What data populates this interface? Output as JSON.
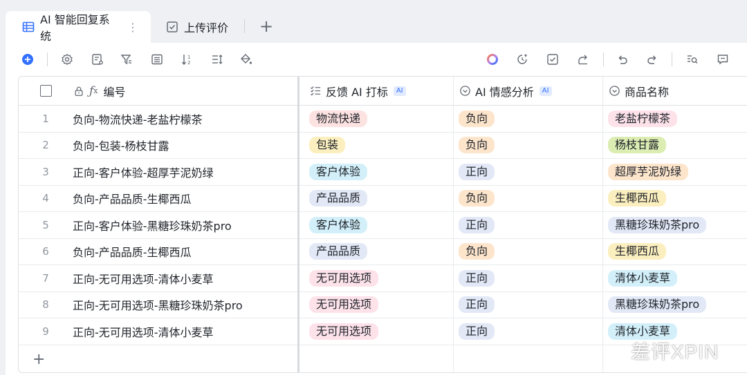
{
  "tabs": [
    {
      "label": "AI 智能回复系统",
      "icon": "table-icon",
      "active": true
    },
    {
      "label": "上传评价",
      "icon": "form-icon",
      "active": false
    }
  ],
  "columns": {
    "index": "",
    "code": "编号",
    "feedback": "反馈 AI 打标",
    "sentiment": "AI 情感分析",
    "product": "商品名称",
    "ai_badge": "AI"
  },
  "rows": [
    {
      "n": "1",
      "code": "负向-物流快递-老盐柠檬茶",
      "feedback": "物流快递",
      "sentiment": "负向",
      "product": "老盐柠檬茶"
    },
    {
      "n": "2",
      "code": "负向-包装-杨枝甘露",
      "feedback": "包装",
      "sentiment": "负向",
      "product": "杨枝甘露"
    },
    {
      "n": "3",
      "code": "正向-客户体验-超厚芋泥奶绿",
      "feedback": "客户体验",
      "sentiment": "正向",
      "product": "超厚芋泥奶绿"
    },
    {
      "n": "4",
      "code": "负向-产品品质-生椰西瓜",
      "feedback": "产品品质",
      "sentiment": "负向",
      "product": "生椰西瓜"
    },
    {
      "n": "5",
      "code": "正向-客户体验-黑糖珍珠奶茶pro",
      "feedback": "客户体验",
      "sentiment": "正向",
      "product": "黑糖珍珠奶茶pro"
    },
    {
      "n": "6",
      "code": "负向-产品品质-生椰西瓜",
      "feedback": "产品品质",
      "sentiment": "负向",
      "product": "生椰西瓜"
    },
    {
      "n": "7",
      "code": "正向-无可用选项-清体小麦草",
      "feedback": "无可用选项",
      "sentiment": "正向",
      "product": "清体小麦草"
    },
    {
      "n": "8",
      "code": "正向-无可用选项-黑糖珍珠奶茶pro",
      "feedback": "无可用选项",
      "sentiment": "正向",
      "product": "黑糖珍珠奶茶pro"
    },
    {
      "n": "9",
      "code": "正向-无可用选项-清体小麦草",
      "feedback": "无可用选项",
      "sentiment": "正向",
      "product": "清体小麦草"
    }
  ],
  "tag_colors": {
    "物流快递": "#fde2e2",
    "包装": "#fcefbf",
    "客户体验": "#d3f0fa",
    "产品品质": "#e2e8f6",
    "无可用选项": "#fde2ea",
    "负向": "#fde5cc",
    "正向": "#e2e8f6",
    "老盐柠檬茶": "#fde2ea",
    "杨枝甘露": "#dcedb3",
    "超厚芋泥奶绿": "#fde5cc",
    "生椰西瓜": "#fcefbf",
    "黑糖珍珠奶茶pro": "#e2e8f6",
    "清体小麦草": "#d3f0fa"
  },
  "add_row": "+",
  "watermark": "差评XPIN",
  "accent": "#3370ff"
}
